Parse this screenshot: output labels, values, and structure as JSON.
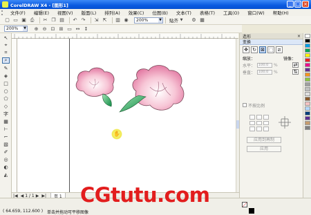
{
  "window": {
    "title": "CorelDRAW X4 - [图形1]"
  },
  "menu": [
    "文件(F)",
    "编辑(E)",
    "视图(V)",
    "版面(L)",
    "排列(A)",
    "效果(C)",
    "位图(B)",
    "文本(T)",
    "表格(T)",
    "工具(O)",
    "窗口(W)",
    "帮助(H)"
  ],
  "toolbar": {
    "zoom_value": "200%",
    "snap_label": "贴齐"
  },
  "propbar": {
    "zoom_value": "200%"
  },
  "pagebar": {
    "page_count": "1 / 1",
    "page_tab": "页 1"
  },
  "docker": {
    "title": "造形",
    "tab": "变换",
    "scale_label": "缩放：",
    "mirror_label": "镜像：",
    "h_label": "水平：",
    "v_label": "垂直：",
    "h_value": "100.0",
    "v_value": "100.0",
    "proportional_label": "不按比例",
    "apply_copy_label": "应用到再制",
    "apply_label": "应用"
  },
  "status": {
    "coords": "( 64.659, 112.600 )",
    "hint": "单击并拖动可平移图像"
  },
  "watermark": "CGtutu.com",
  "palette": [
    "#ffffff",
    "#000000",
    "#00a0e9",
    "#00a651",
    "#fff200",
    "#ed1c24",
    "#ec008c",
    "#662d91",
    "#f7941d",
    "#8dc63f",
    "#a0a0a0",
    "#c0c0c0",
    "#e0e0e0",
    "#8b5a2b",
    "#f4c2c2",
    "#b3d9ff",
    "#003d7a",
    "#5c2d91",
    "#c69c6d",
    "#7f7f7f"
  ],
  "icons": {
    "new": "new-document-icon",
    "open": "open-folder-icon",
    "save": "save-icon",
    "undo": "undo-icon",
    "redo": "redo-icon",
    "zoom": "zoom-icon",
    "hand": "hand-pan-icon"
  }
}
